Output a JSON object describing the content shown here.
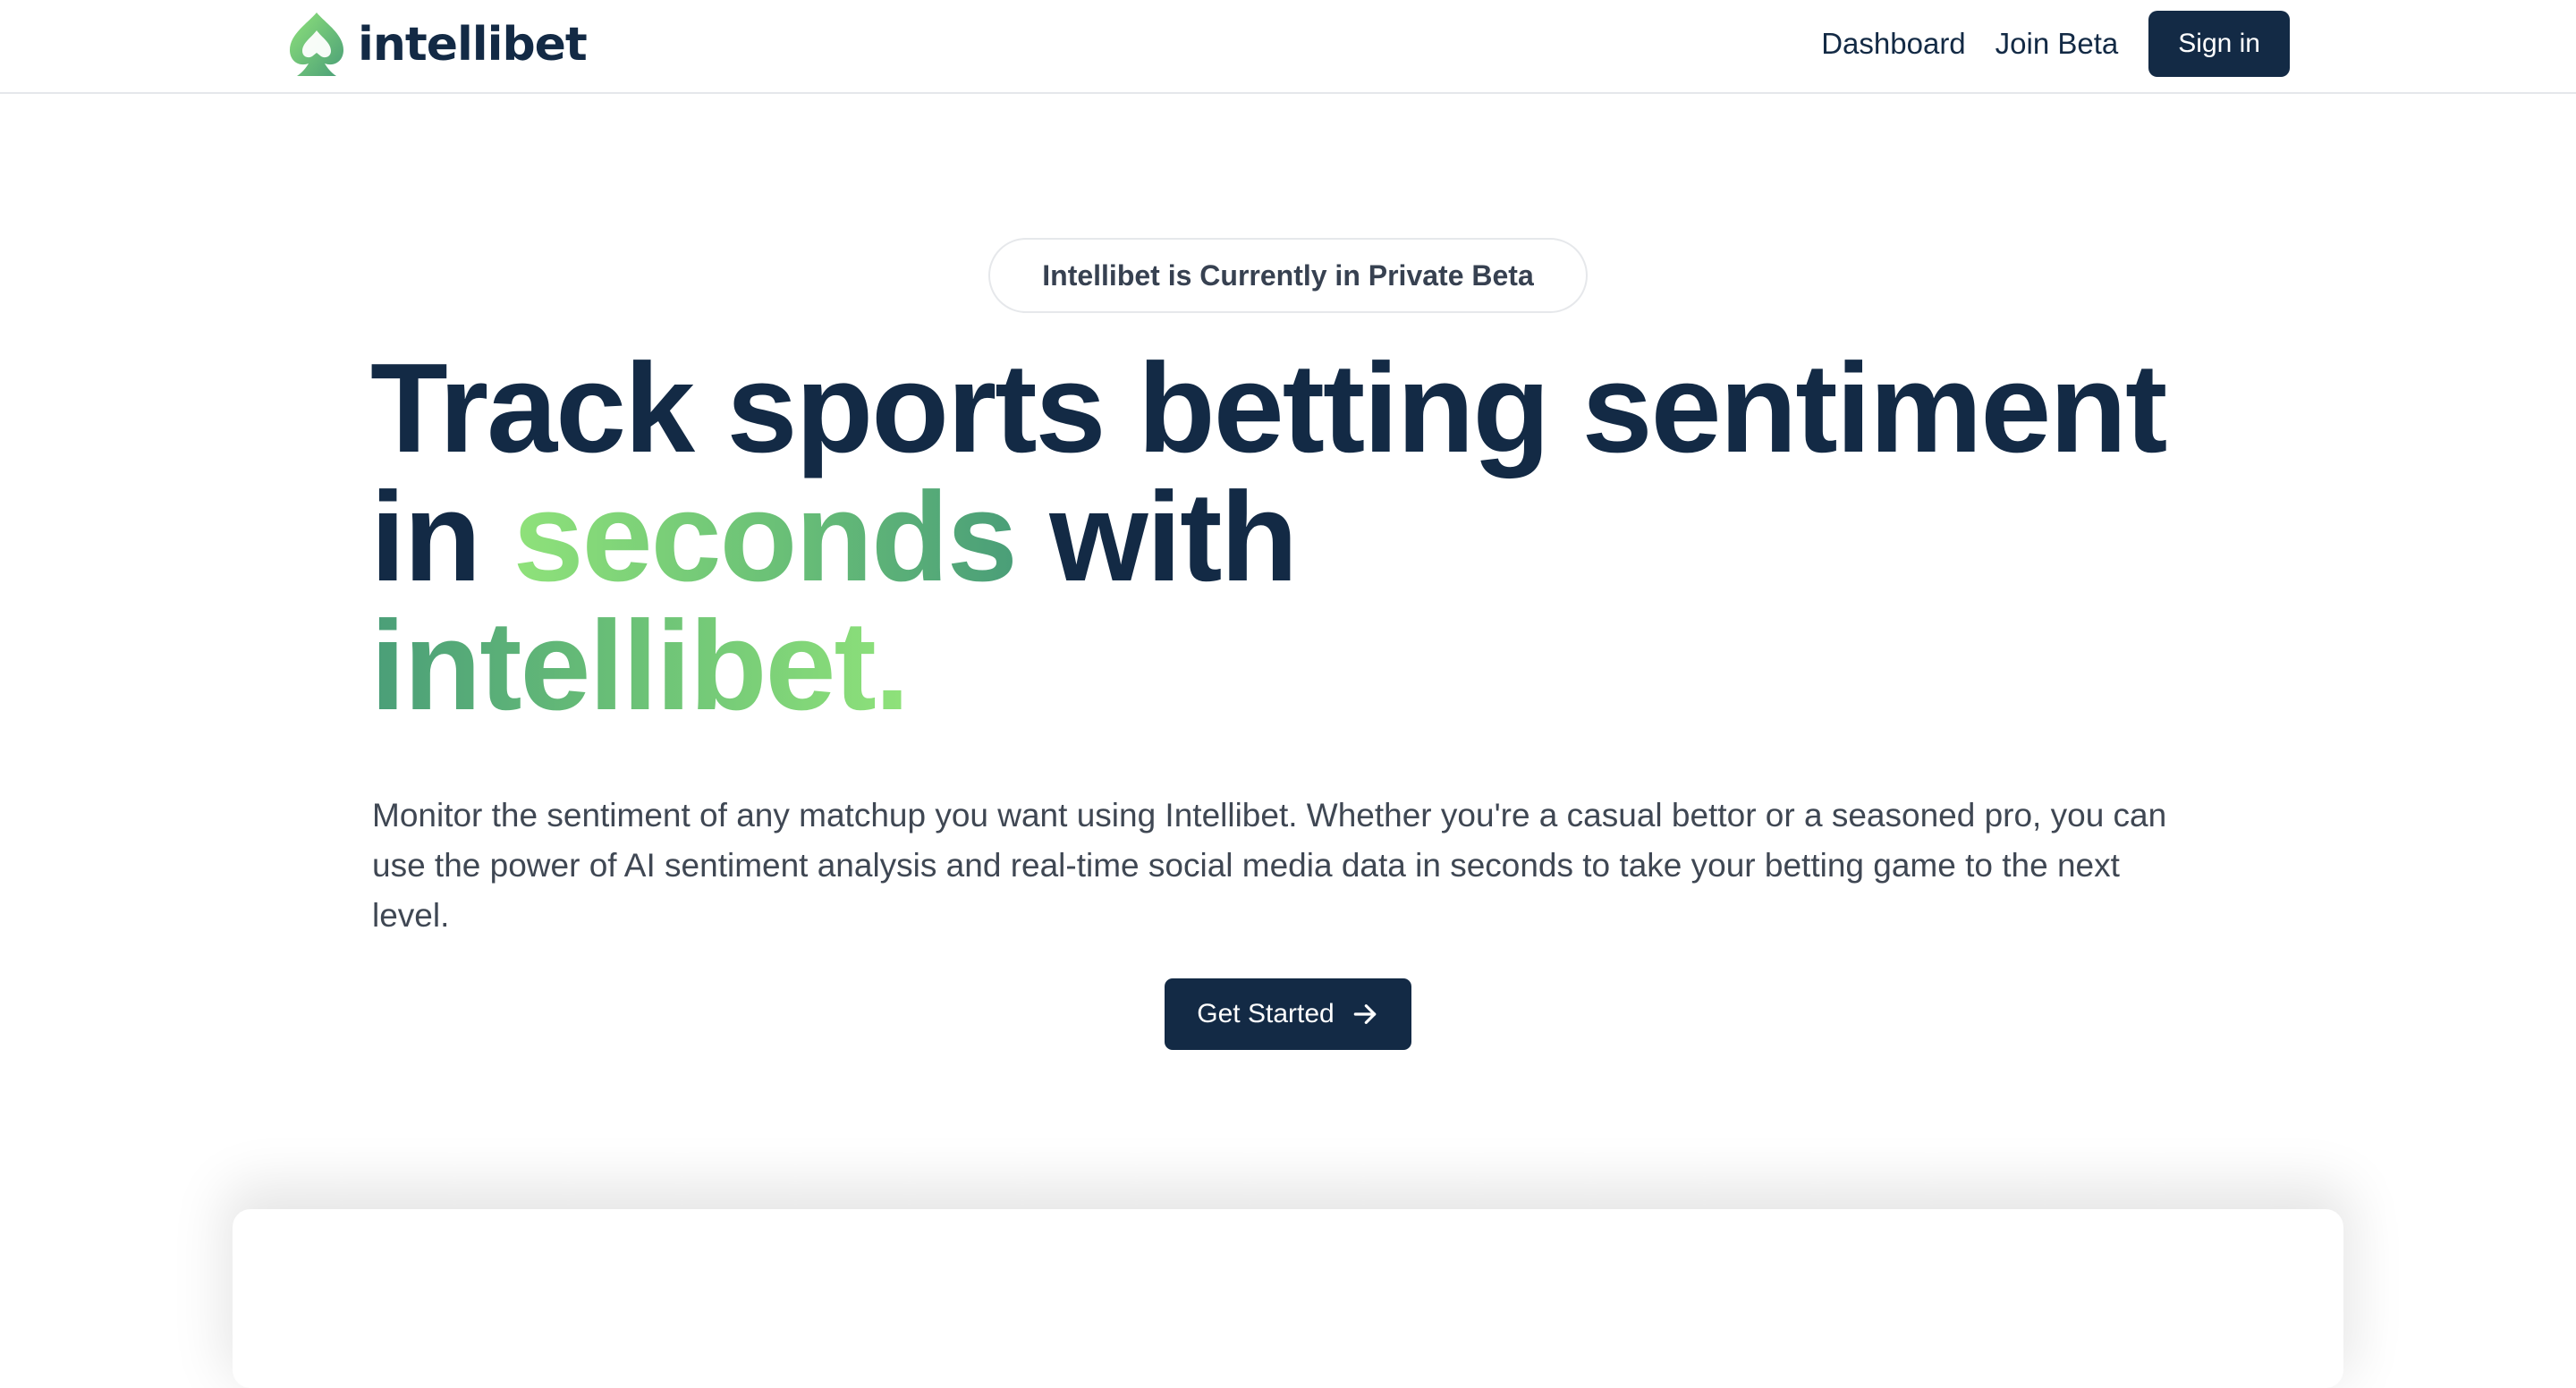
{
  "header": {
    "brand_name": "intellibet",
    "nav": {
      "dashboard_label": "Dashboard",
      "join_beta_label": "Join Beta",
      "sign_in_label": "Sign in"
    }
  },
  "hero": {
    "beta_badge": "Intellibet is Currently in Private Beta",
    "headline": {
      "part1": "Track sports betting sentiment in ",
      "highlight1": "seconds",
      "part2": " with ",
      "highlight2": "intellibet."
    },
    "description": "Monitor the sentiment of any matchup you want using Intellibet. Whether you're a casual bettor or a seasoned pro, you can use the power of AI sentiment analysis and real-time social media data in seconds to take your betting game to the next level.",
    "cta_label": "Get Started"
  },
  "icons": {
    "logo": "spade-logo-icon",
    "cta": "arrow-right-icon"
  },
  "colors": {
    "primary": "#132a45",
    "accent_light": "#8fe27a",
    "accent_dark": "#4a9e78",
    "body_text": "#3f4753",
    "border": "#e5e7eb"
  }
}
